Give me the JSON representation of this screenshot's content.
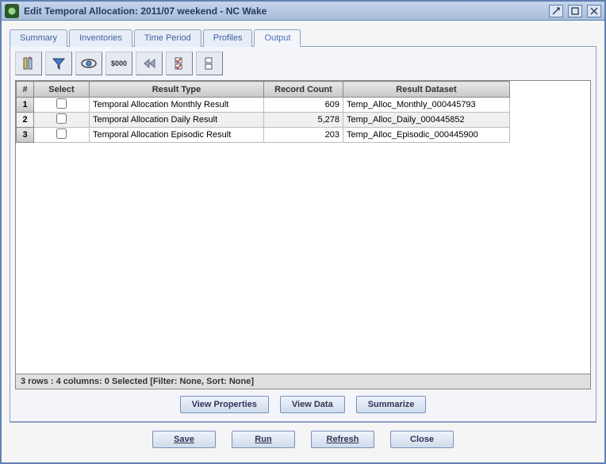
{
  "window": {
    "title": "Edit Temporal Allocation: 2011/07 weekend - NC Wake"
  },
  "tabs": [
    "Summary",
    "Inventories",
    "Time Period",
    "Profiles",
    "Output"
  ],
  "active_tab": "Output",
  "toolbar_icons": [
    "columns-icon",
    "filter-icon",
    "view-icon",
    "format-icon",
    "first-icon",
    "check-icon",
    "uncheck-icon"
  ],
  "toolbar_labels": {
    "format": "$000"
  },
  "table": {
    "headers": [
      "#",
      "Select",
      "Result Type",
      "Record Count",
      "Result Dataset"
    ],
    "rows": [
      {
        "num": "1",
        "selected": false,
        "type": "Temporal Allocation Monthly Result",
        "count": "609",
        "dataset": "Temp_Alloc_Monthly_000445793"
      },
      {
        "num": "2",
        "selected": false,
        "type": "Temporal Allocation Daily Result",
        "count": "5,278",
        "dataset": "Temp_Alloc_Daily_000445852"
      },
      {
        "num": "3",
        "selected": false,
        "type": "Temporal Allocation Episodic Result",
        "count": "203",
        "dataset": "Temp_Alloc_Episodic_000445900"
      }
    ]
  },
  "status": "3 rows : 4 columns: 0 Selected [Filter: None, Sort: None]",
  "panel_buttons": {
    "view_properties": "View Properties",
    "view_data": "View Data",
    "summarize": "Summarize"
  },
  "bottom_buttons": {
    "save": "Save",
    "run": "Run",
    "refresh": "Refresh",
    "close": "Close"
  }
}
